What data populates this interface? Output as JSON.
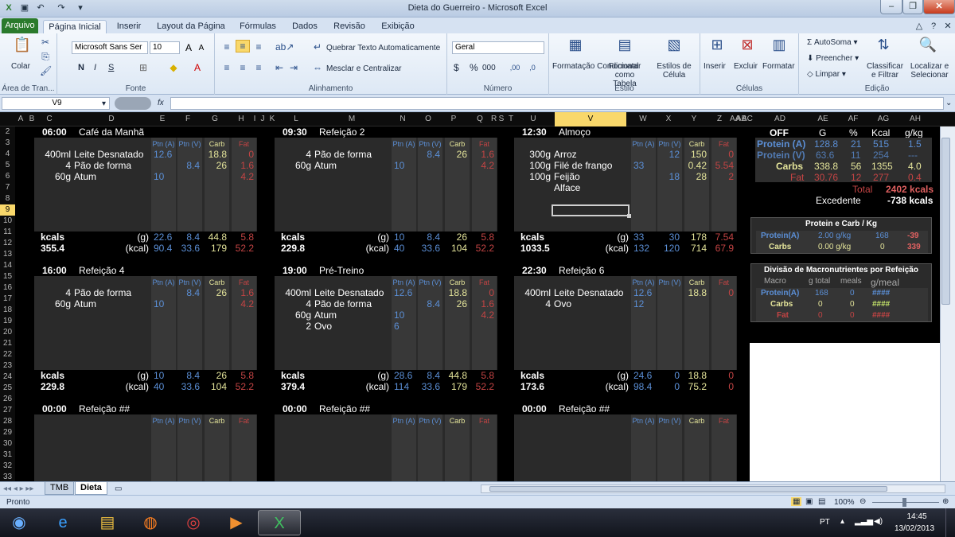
{
  "window": {
    "title": "Dieta do Guerreiro - Microsoft Excel"
  },
  "tabs": [
    "Arquivo",
    "Página Inicial",
    "Inserir",
    "Layout da Página",
    "Fórmulas",
    "Dados",
    "Revisão",
    "Exibição"
  ],
  "ribbon": {
    "clipboard": {
      "paste": "Colar",
      "label": "Área de Tran..."
    },
    "font": {
      "name": "Microsoft Sans Ser",
      "size": "10",
      "bold": "N",
      "italic": "I",
      "underline": "S",
      "label": "Fonte"
    },
    "alignment": {
      "wrap": "Quebrar Texto Automaticamente",
      "merge": "Mesclar e Centralizar",
      "label": "Alinhamento"
    },
    "number": {
      "format": "Geral",
      "currency": "$",
      "percent": "%",
      "thousands": "000",
      "label": "Número"
    },
    "styles": {
      "cond": "Formatação Condicional",
      "table": "Formatar como Tabela",
      "cell": "Estilos de Célula",
      "label": "Estilo"
    },
    "cells": {
      "insert": "Inserir",
      "delete": "Excluir",
      "format": "Formatar",
      "label": "Células"
    },
    "editing": {
      "autosum": "AutoSoma",
      "fill": "Preencher",
      "clear": "Limpar",
      "sort": "Classificar e Filtrar",
      "find": "Localizar e Selecionar",
      "label": "Edição"
    }
  },
  "namebox": "V9",
  "fx": "fx",
  "columns": [
    "A",
    "B",
    "C",
    "D",
    "E",
    "F",
    "G",
    "H",
    "I",
    "J",
    "K",
    "L",
    "M",
    "N",
    "O",
    "P",
    "Q",
    "R",
    "S",
    "T",
    "U",
    "V",
    "W",
    "X",
    "Y",
    "Z",
    "AA",
    "AB",
    "AC",
    "AD",
    "AE",
    "AF",
    "AG",
    "AH"
  ],
  "rows": [
    "2",
    "3",
    "4",
    "5",
    "6",
    "7",
    "8",
    "9",
    "10",
    "11",
    "12",
    "13",
    "14",
    "15",
    "16",
    "17",
    "18",
    "19",
    "20",
    "21",
    "22",
    "23",
    "24",
    "25",
    "26",
    "27",
    "28",
    "29",
    "30",
    "31",
    "32",
    "33",
    "34"
  ],
  "meal_col_labels": {
    "pa": "Ptn (A)",
    "pv": "Ptn (V)",
    "carb": "Carb",
    "fat": "Fat"
  },
  "footer_labels": {
    "kcals": "kcals",
    "g": "(g)",
    "kcal": "(kcal)"
  },
  "meals": [
    {
      "time": "06:00",
      "name": "Café da Manhã",
      "items": [
        {
          "q": "400ml",
          "food": "Leite Desnatado",
          "pa": "12.6",
          "pv": "",
          "carb": "18.8",
          "fat": "0"
        },
        {
          "q": "4",
          "food": "Pão de forma",
          "pa": "",
          "pv": "8.4",
          "carb": "26",
          "fat": "1.6"
        },
        {
          "q": "60g",
          "food": "Atum",
          "pa": "10",
          "pv": "",
          "carb": "",
          "fat": "4.2"
        }
      ],
      "kcal_total": "355.4",
      "g": [
        "22.6",
        "8.4",
        "44.8",
        "5.8"
      ],
      "kc": [
        "90.4",
        "33.6",
        "179",
        "52.2"
      ]
    },
    {
      "time": "09:30",
      "name": "Refeição 2",
      "items": [
        {
          "q": "4",
          "food": "Pão de forma",
          "pa": "",
          "pv": "8.4",
          "carb": "26",
          "fat": "1.6"
        },
        {
          "q": "60g",
          "food": "Atum",
          "pa": "10",
          "pv": "",
          "carb": "",
          "fat": "4.2"
        }
      ],
      "kcal_total": "229.8",
      "g": [
        "10",
        "8.4",
        "26",
        "5.8"
      ],
      "kc": [
        "40",
        "33.6",
        "104",
        "52.2"
      ]
    },
    {
      "time": "12:30",
      "name": "Almoço",
      "items": [
        {
          "q": "300g",
          "food": "Arroz",
          "pa": "",
          "pv": "12",
          "carb": "150",
          "fat": "0"
        },
        {
          "q": "100g",
          "food": "Filé de frango",
          "pa": "33",
          "pv": "",
          "carb": "0.42",
          "fat": "5.54"
        },
        {
          "q": "100g",
          "food": "Feijão",
          "pa": "",
          "pv": "18",
          "carb": "28",
          "fat": "2"
        },
        {
          "q": "",
          "food": "Alface",
          "pa": "",
          "pv": "",
          "carb": "",
          "fat": ""
        }
      ],
      "kcal_total": "1033.5",
      "g": [
        "33",
        "30",
        "178",
        "7.54"
      ],
      "kc": [
        "132",
        "120",
        "714",
        "67.9"
      ]
    },
    {
      "time": "16:00",
      "name": "Refeição 4",
      "items": [
        {
          "q": "4",
          "food": "Pão de forma",
          "pa": "",
          "pv": "8.4",
          "carb": "26",
          "fat": "1.6"
        },
        {
          "q": "60g",
          "food": "Atum",
          "pa": "10",
          "pv": "",
          "carb": "",
          "fat": "4.2"
        }
      ],
      "kcal_total": "229.8",
      "g": [
        "10",
        "8.4",
        "26",
        "5.8"
      ],
      "kc": [
        "40",
        "33.6",
        "104",
        "52.2"
      ]
    },
    {
      "time": "19:00",
      "name": "Pré-Treino",
      "items": [
        {
          "q": "400ml",
          "food": "Leite Desnatado",
          "pa": "12.6",
          "pv": "",
          "carb": "18.8",
          "fat": "0"
        },
        {
          "q": "4",
          "food": "Pão de forma",
          "pa": "",
          "pv": "8.4",
          "carb": "26",
          "fat": "1.6"
        },
        {
          "q": "60g",
          "food": "Atum",
          "pa": "10",
          "pv": "",
          "carb": "",
          "fat": "4.2"
        },
        {
          "q": "2",
          "food": "Ovo",
          "pa": "6",
          "pv": "",
          "carb": "",
          "fat": ""
        }
      ],
      "kcal_total": "379.4",
      "g": [
        "28.6",
        "8.4",
        "44.8",
        "5.8"
      ],
      "kc": [
        "114",
        "33.6",
        "179",
        "52.2"
      ]
    },
    {
      "time": "22:30",
      "name": "Refeição 6",
      "items": [
        {
          "q": "400ml",
          "food": "Leite Desnatado",
          "pa": "12.6",
          "pv": "",
          "carb": "18.8",
          "fat": "0"
        },
        {
          "q": "4",
          "food": "Ovo",
          "pa": "12",
          "pv": "",
          "carb": "",
          "fat": ""
        }
      ],
      "kcal_total": "173.6",
      "g": [
        "24.6",
        "0",
        "18.8",
        "0"
      ],
      "kc": [
        "98.4",
        "0",
        "75.2",
        "0"
      ]
    },
    {
      "time": "00:00",
      "name": "Refeição ##",
      "items": [],
      "kcal_total": "",
      "g": [],
      "kc": []
    },
    {
      "time": "00:00",
      "name": "Refeição ##",
      "items": [],
      "kcal_total": "",
      "g": [],
      "kc": []
    },
    {
      "time": "00:00",
      "name": "Refeição ##",
      "items": [],
      "kcal_total": "",
      "g": [],
      "kc": []
    }
  ],
  "summary": {
    "hdr": [
      "OFF",
      "G",
      "%",
      "Kcal",
      "g/kg"
    ],
    "rows": [
      {
        "name": "Protein (A)",
        "g": "128.8",
        "pct": "21",
        "kcal": "515",
        "gkg": "1.5"
      },
      {
        "name": "Protein (V)",
        "g": "63.6",
        "pct": "11",
        "kcal": "254",
        "gkg": "---"
      },
      {
        "name": "Carbs",
        "g": "338.8",
        "pct": "56",
        "kcal": "1355",
        "gkg": "4.0"
      },
      {
        "name": "Fat",
        "g": "30.76",
        "pct": "12",
        "kcal": "277",
        "gkg": "0.4"
      }
    ],
    "total_label": "Total",
    "total": "2402 kcals",
    "excess_label": "Excedente",
    "excess": "-738 kcals"
  },
  "pc": {
    "title": "Protein e Carb / Kg",
    "rows": [
      {
        "name": "Protein(A)",
        "gkg": "2.00 g/kg",
        "val": "168",
        "diff": "-39"
      },
      {
        "name": "Carbs",
        "gkg": "0.00 g/kg",
        "val": "0",
        "diff": "339"
      }
    ]
  },
  "div": {
    "title": "Divisão de Macronutrientes por Refeição",
    "hdr": [
      "Macro",
      "g total",
      "meals",
      "g/meal"
    ],
    "rows": [
      {
        "name": "Protein(A)",
        "gt": "168",
        "m": "0",
        "gm": "####"
      },
      {
        "name": "Carbs",
        "gt": "0",
        "m": "0",
        "gm": "####"
      },
      {
        "name": "Fat",
        "gt": "0",
        "m": "0",
        "gm": "####"
      }
    ]
  },
  "sheets": [
    "TMB",
    "Dieta"
  ],
  "status": {
    "ready": "Pronto",
    "zoom": "100%"
  },
  "clock": {
    "lang": "PT",
    "time": "14:45",
    "date": "13/02/2013"
  },
  "colors": {
    "blue": "#5b8fd6",
    "carb": "#e4e49a",
    "fat": "#c44444",
    "excel_green": "#2a7a2c"
  }
}
